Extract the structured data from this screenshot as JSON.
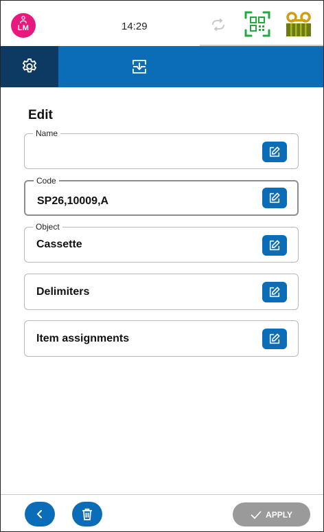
{
  "status_bar": {
    "user_initials": "LM",
    "time": "14:29",
    "icons": [
      "person-icon",
      "sync-icon",
      "qr-code-icon",
      "tape-icon"
    ],
    "avatar_color": "#e8197d",
    "qr_icon_color": "#1faa3c",
    "tape_icon_color": "#d39e0c"
  },
  "tab_bar": {
    "tabs": [
      {
        "icon": "gear-icon",
        "active": true
      },
      {
        "icon": "import-icon",
        "active": false
      }
    ],
    "color": "#0b6cb7",
    "active_color": "#0d3a63"
  },
  "page": {
    "title": "Edit"
  },
  "fields": {
    "name": {
      "label": "Name",
      "value": ""
    },
    "code": {
      "label": "Code",
      "value": "SP26,10009,A"
    },
    "object": {
      "label": "Object",
      "value": "Cassette"
    },
    "delimiters": {
      "value": "Delimiters"
    },
    "item_assignments": {
      "value": "Item assignments"
    }
  },
  "footer": {
    "back_icon": "chevron-left-icon",
    "delete_icon": "trash-icon",
    "apply_label": "APPLY",
    "apply_icon": "check-icon",
    "apply_enabled": false
  }
}
